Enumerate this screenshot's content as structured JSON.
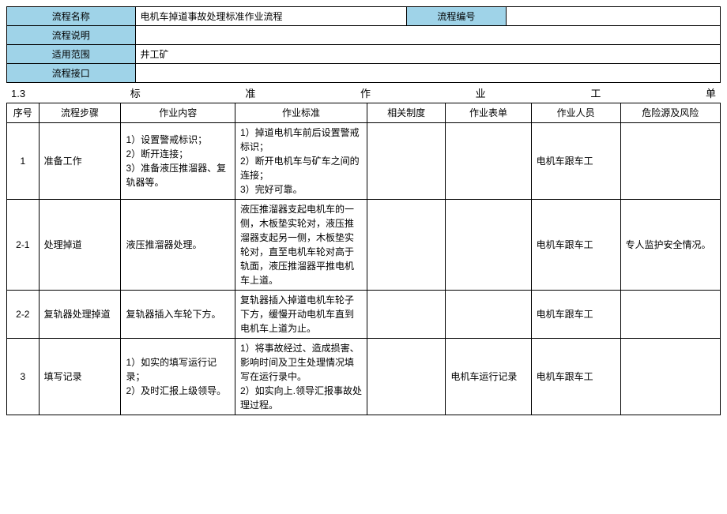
{
  "meta": {
    "labels": {
      "name": "流程名称",
      "code": "流程编号",
      "desc": "流程说明",
      "scope": "适用范围",
      "interface": "流程接口"
    },
    "values": {
      "name": "电机车掉道事故处理标准作业流程",
      "code": "",
      "desc": "",
      "scope": "井工矿",
      "interface": ""
    }
  },
  "section_title": "1.3标准作业工单",
  "columns": {
    "seq": "序号",
    "step": "流程步骤",
    "content": "作业内容",
    "standard": "作业标准",
    "system": "相关制度",
    "form": "作业表单",
    "person": "作业人员",
    "risk": "危险源及风险"
  },
  "rows": [
    {
      "seq": "1",
      "step": "准备工作",
      "content": "1）设置警戒标识；\n2）断开连接；\n3）准备液压推溜器、复轨器等。",
      "standard": "1）掉道电机车前后设置警戒标识；\n2）断开电机车与矿车之间的连接；\n3）完好可靠。",
      "system": "",
      "form": "",
      "person": "电机车跟车工",
      "risk": ""
    },
    {
      "seq": "2-1",
      "step": "处理掉道",
      "content": "液压推溜器处理。",
      "standard": "液压推溜器支起电机车的一侧，木板垫实轮对，液压推溜器支起另一侧，木板垫实轮对，直至电机车轮对高于轨面，液压推溜器平推电机车上道。",
      "system": "",
      "form": "",
      "person": "电机车跟车工",
      "risk": "专人监护安全情况。"
    },
    {
      "seq": "2-2",
      "step": "复轨器处理掉道",
      "content": "复轨器插入车轮下方。",
      "standard": "复轨器插入掉道电机车轮子下方，缓慢开动电机车直到电机车上道为止。",
      "system": "",
      "form": "",
      "person": "电机车跟车工",
      "risk": ""
    },
    {
      "seq": "3",
      "step": "填写记录",
      "content": "1）如实的填写运行记录；\n2）及时汇报上级领导。",
      "standard": "1）将事故经过、造成损害、影响时间及卫生处理情况填写在运行录中。\n2）如实向上.领导汇报事故处理过程。",
      "system": "",
      "form": "电机车运行记录",
      "person": "电机车跟车工",
      "risk": ""
    }
  ]
}
